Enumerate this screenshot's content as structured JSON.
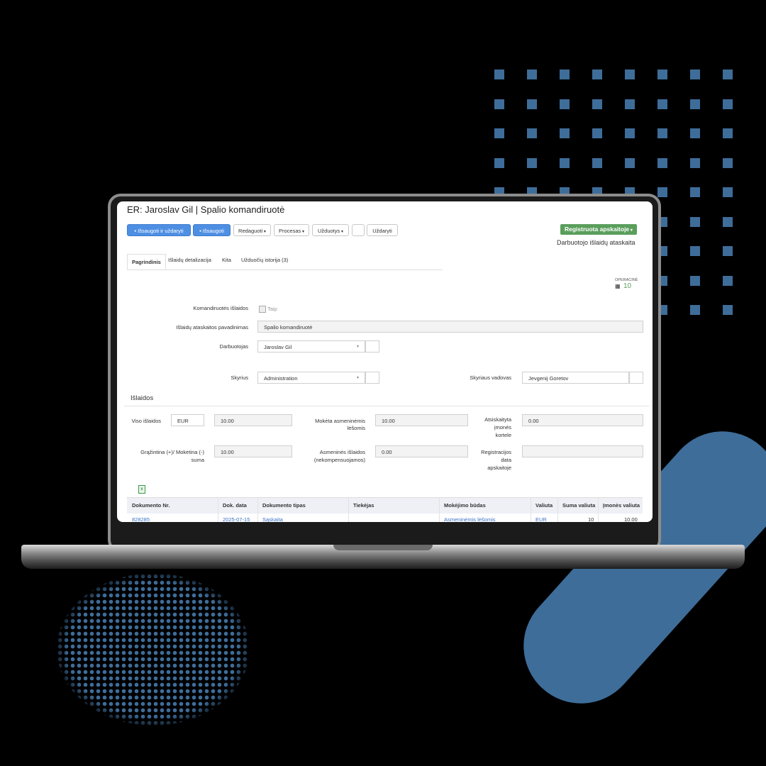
{
  "colors": {
    "accent": "#4e8fe3",
    "status": "#5a9e5c",
    "decor": "#3e6d99"
  },
  "header": {
    "title": "ER: Jaroslav Gil | Spalio komandiruotė",
    "status_badge": "Registruota apskaitoje",
    "doc_type": "Darbuotojo išlaidų ataskaita"
  },
  "toolbar": {
    "save_close": "Išsaugoti ir uždaryti",
    "save": "Išsaugoti",
    "edit": "Redaguoti",
    "process": "Procesas",
    "tasks": "Užduotys",
    "close": "Uždaryti"
  },
  "tabs": [
    {
      "label": "Pagrindinis"
    },
    {
      "label": "Išlaidų detalizacija"
    },
    {
      "label": "Kita"
    },
    {
      "label": "Užduočių istorija (3)"
    }
  ],
  "counter": {
    "label": "OPERACINĖ",
    "value": "10",
    "icon": "calculator-icon"
  },
  "form": {
    "trip_expenses_label": "Komandiruotės išlaidos",
    "trip_expenses_check": "Taip",
    "report_name_label": "Išlaidų ataskaitos pavadinimas",
    "report_name_value": "Spalio komandiruotė",
    "employee_label": "Darbuotojas",
    "employee_value": "Jaroslav Gil",
    "department_label": "Skyrius",
    "department_value": "Administration",
    "head_label": "Skyriaus vadovas",
    "head_value": "Jevgenij Goretov"
  },
  "expenses": {
    "section_title": "Išlaidos",
    "total_label": "Viso išlaidos",
    "currency": "EUR",
    "total_value": "10.00",
    "paid_personal_label_1": "Mokėta asmeninėmis",
    "paid_personal_label_2": "lėšomis",
    "paid_personal_value": "10.00",
    "company_card_label_1": "Atsiskaityta",
    "company_card_label_2": "įmonės",
    "company_card_label_3": "kortele",
    "company_card_value": "0.00",
    "refund_label_1": "Grąžintina (+)/ Mokėtina (-)",
    "refund_label_2": "suma",
    "refund_value": "10.00",
    "personal_label_1": "Asmeninės išlaidos",
    "personal_label_2": "(nekompensuojamos)",
    "personal_value": "0.00",
    "reg_date_label_1": "Registracijos",
    "reg_date_label_2": "data",
    "reg_date_label_3": "apskaitoje",
    "reg_date_value": "",
    "export_icon": "excel-icon"
  },
  "table": {
    "headers": [
      "Dokumento Nr.",
      "Dok. data",
      "Dokumento tipas",
      "Tiekėjas",
      "Mokėjimo būdas",
      "Valiuta",
      "Suma valiuta",
      "Įmonės valiuta"
    ],
    "rows": [
      {
        "doc_no": "828285",
        "date": "2025-07-15",
        "type": "Sąskaita",
        "supplier": "",
        "payment": "Asmeninėmis lėšomis",
        "currency": "EUR",
        "amount": "10",
        "company_amount": "10.00"
      }
    ]
  }
}
